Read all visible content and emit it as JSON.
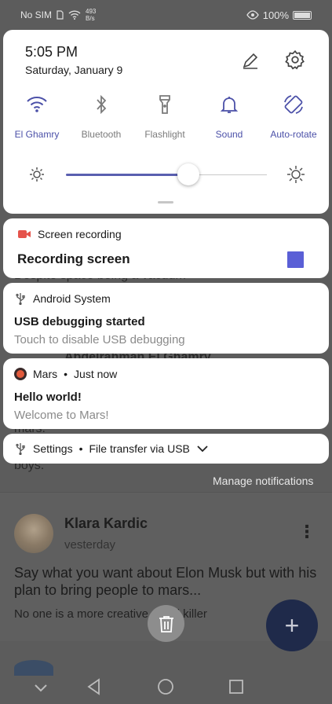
{
  "status_bar": {
    "sim": "No SIM",
    "net_speed_value": "493",
    "net_speed_unit": "B/s",
    "battery": "100%"
  },
  "quick_settings": {
    "time": "5:05 PM",
    "date": "Saturday, January 9",
    "tiles": [
      {
        "label": "El Ghamry",
        "icon": "wifi-icon",
        "active": true
      },
      {
        "label": "Bluetooth",
        "icon": "bluetooth-icon",
        "active": false
      },
      {
        "label": "Flashlight",
        "icon": "flashlight-icon",
        "active": false
      },
      {
        "label": "Sound",
        "icon": "bell-icon",
        "active": true
      },
      {
        "label": "Auto-rotate",
        "icon": "rotate-icon",
        "active": true
      }
    ],
    "brightness": 0.61,
    "accent_color": "#4b50a8"
  },
  "notifications": {
    "recording": {
      "app": "Screen recording",
      "title": "Recording screen",
      "icon": "video-camera-icon",
      "icon_color": "#e5534b",
      "stop_color": "#5a5fd6"
    },
    "android": {
      "app": "Android System",
      "title": "USB debugging started",
      "text": "Touch to disable USB debugging",
      "icon": "usb-icon"
    },
    "mars": {
      "app": "Mars",
      "time": "Just now",
      "title": "Hello world!",
      "text": "Welcome to Mars!",
      "icon": "mars-app-icon"
    },
    "settings": {
      "app": "Settings",
      "detail": "File transfer via USB",
      "icon": "usb-icon"
    },
    "manage_label": "Manage notifications"
  },
  "background_app": {
    "peek_texts": [
      "Despite space being a vacuum",
      "Abdelrahman El Ghamry",
      "mars.",
      "boys."
    ],
    "post": {
      "author": "Klara Kardic",
      "time": "vesterday",
      "text": "Say what you want about Elon Musk but with his plan to bring people to mars...",
      "subtext": "No one is a more creative serial killer"
    },
    "fab_label": "+"
  }
}
